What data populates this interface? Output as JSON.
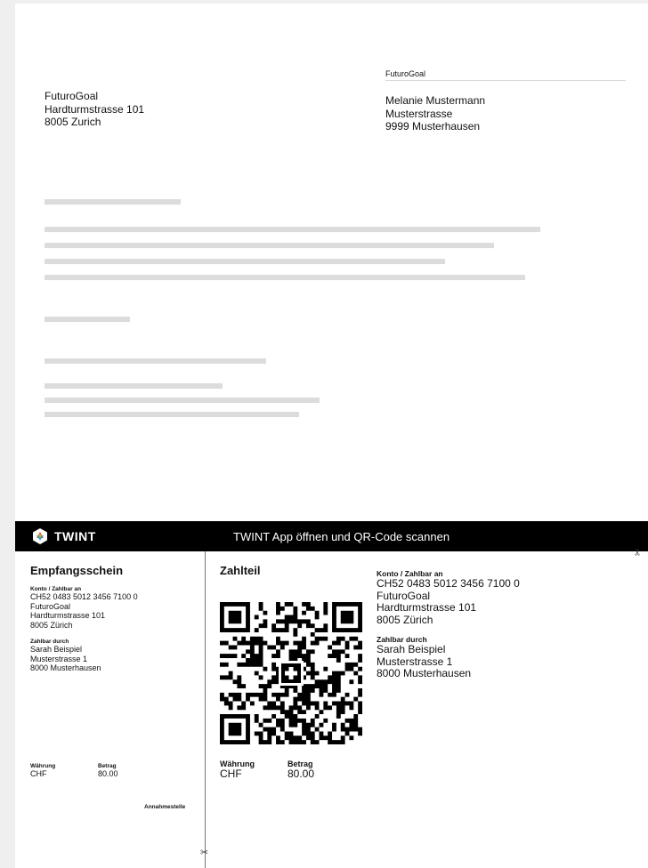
{
  "letter": {
    "sender": {
      "name": "FuturoGoal",
      "street": "Hardturmstrasse 101",
      "city": "8005 Zurich"
    },
    "sender_line": "FuturoGoal",
    "recipient": {
      "name": "Melanie Mustermann",
      "street": "Musterstrasse",
      "city": "9999 Musterhausen"
    }
  },
  "twint": {
    "logo": "TWINT",
    "instruction": "TWINT App öffnen und QR-Code scannen"
  },
  "receipt": {
    "title": "Empfangsschein",
    "account_label": "Konto / Zahlbar an",
    "iban": "CH52 0483 5012 3456 7100 0",
    "creditor": "FuturoGoal",
    "creditor_street": "Hardturmstrasse 101",
    "creditor_city": "8005 Zürich",
    "payable_by_label": "Zahlbar durch",
    "debtor": "Sarah Beispiel",
    "debtor_street": "Musterstrasse 1",
    "debtor_city": "8000 Musterhausen",
    "currency_label": "Währung",
    "currency": "CHF",
    "amount_label": "Betrag",
    "amount": "80.00",
    "acceptance_point": "Annahmestelle"
  },
  "payment": {
    "title": "Zahlteil",
    "currency_label": "Währung",
    "currency": "CHF",
    "amount_label": "Betrag",
    "amount": "80.00",
    "account_label": "Konto / Zahlbar an",
    "iban": "CH52 0483 5012 3456 7100 0",
    "creditor": "FuturoGoal",
    "creditor_street": "Hardturmstrasse 101",
    "creditor_city": "8005 Zürich",
    "payable_by_label": "Zahlbar durch",
    "debtor": "Sarah Beispiel",
    "debtor_street": "Musterstrasse 1",
    "debtor_city": "8000 Musterhausen"
  },
  "icons": {
    "scissors": "✂"
  }
}
